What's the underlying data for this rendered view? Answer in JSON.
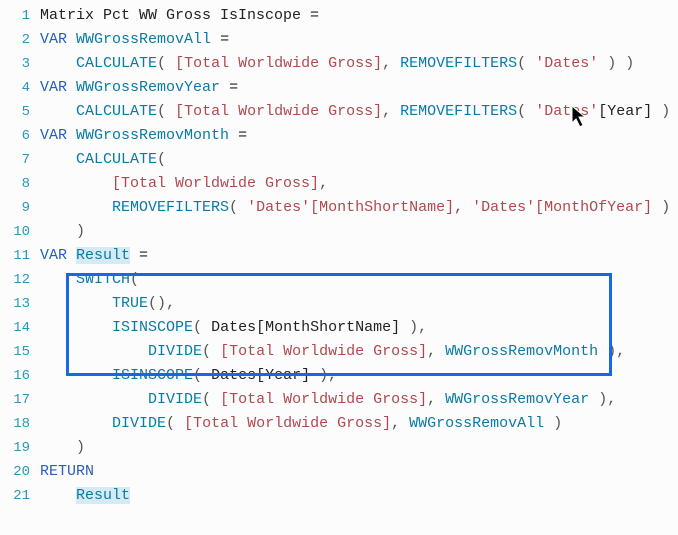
{
  "gutter": [
    "1",
    "2",
    "3",
    "4",
    "5",
    "6",
    "7",
    "8",
    "9",
    "10",
    "11",
    "12",
    "13",
    "14",
    "15",
    "16",
    "17",
    "18",
    "19",
    "20",
    "21"
  ],
  "tokens": {
    "measureName": "Matrix Pct WW Gross IsInscope",
    "eq": " =",
    "var": "VAR",
    "return": "RETURN",
    "wgAll": "WWGrossRemovAll",
    "wgYear": "WWGrossRemovYear",
    "wgMonth": "WWGrossRemovMonth",
    "result": "Result",
    "calc": "CALCULATE",
    "removefilters": "REMOVEFILTERS",
    "switch": "SWITCH",
    "true": "TRUE",
    "isinscope": "ISINSCOPE",
    "divide": "DIVIDE",
    "measTotal": "[Total Worldwide Gross]",
    "tblDates": "'Dates'",
    "colYearBr": "[Year]",
    "refDatesYear": "Dates[Year]",
    "refDatesMonth": "Dates[MonthShortName]",
    "colMonthShort": "'Dates'[MonthShortName]",
    "colMonthOfYear": "'Dates'[MonthOfYear]",
    "lp": "(",
    "rp": ")",
    "comma": ",",
    "sp1": " ",
    "sp4": "    ",
    "sp8": "        ",
    "sp12": "            ",
    "barB": " | ",
    "barE": " ) )"
  }
}
